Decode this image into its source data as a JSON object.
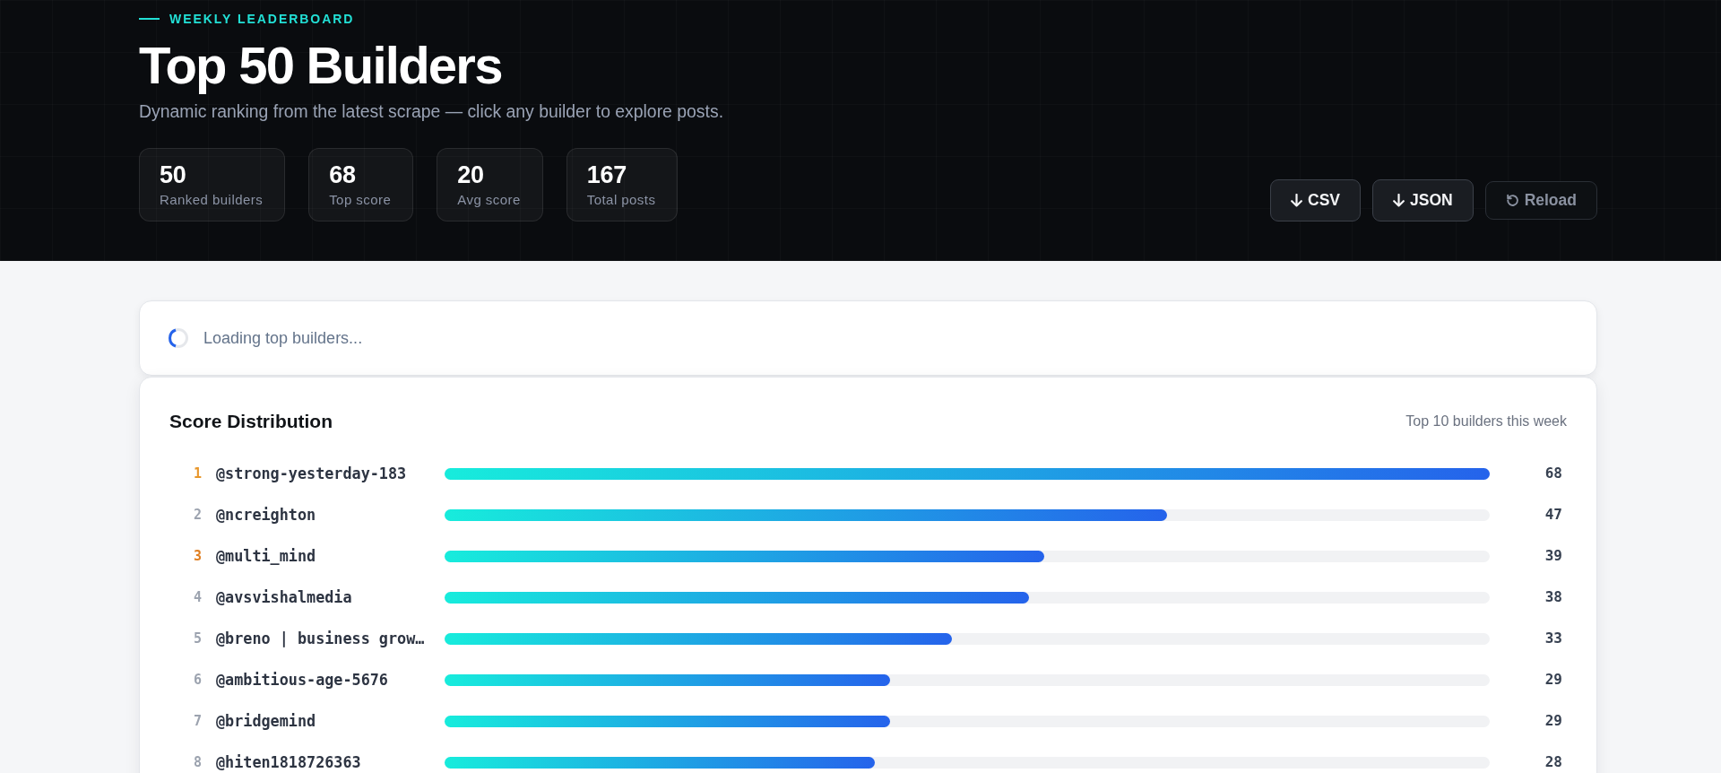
{
  "header": {
    "eyebrow": "WEEKLY LEADERBOARD",
    "title": "Top 50 Builders",
    "subtitle": "Dynamic ranking from the latest scrape — click any builder to explore posts.",
    "stats": [
      {
        "value": "50",
        "label": "Ranked builders"
      },
      {
        "value": "68",
        "label": "Top score"
      },
      {
        "value": "20",
        "label": "Avg score"
      },
      {
        "value": "167",
        "label": "Total posts"
      }
    ],
    "buttons": [
      {
        "kind": "download",
        "label": "CSV",
        "disabled": false
      },
      {
        "kind": "download",
        "label": "JSON",
        "disabled": false
      },
      {
        "kind": "reload",
        "label": "Reload",
        "disabled": true
      }
    ]
  },
  "loading": {
    "text": "Loading top builders..."
  },
  "distribution": {
    "title": "Score Distribution",
    "caption": "Top 10 builders this week",
    "rows": [
      {
        "rank": "1",
        "color": "#e8962a",
        "name": "@strong-yesterday-183",
        "level": 1,
        "score": "68"
      },
      {
        "rank": "2",
        "color": "#9ca3af",
        "name": "@ncreighton",
        "level": 0.691,
        "score": "47"
      },
      {
        "rank": "3",
        "color": "#e07f22",
        "name": "@multi_mind",
        "level": 0.574,
        "score": "39"
      },
      {
        "rank": "4",
        "color": "#9ca3af",
        "name": "@avsvishalmedia",
        "level": 0.559,
        "score": "38"
      },
      {
        "rank": "5",
        "color": "#9ca3af",
        "name": "@breno | business grow…",
        "level": 0.485,
        "score": "33"
      },
      {
        "rank": "6",
        "color": "#9ca3af",
        "name": "@ambitious-age-5676",
        "level": 0.426,
        "score": "29"
      },
      {
        "rank": "7",
        "color": "#9ca3af",
        "name": "@bridgemind",
        "level": 0.426,
        "score": "29"
      },
      {
        "rank": "8",
        "color": "#9ca3af",
        "name": "@hiten1818726363",
        "level": 0.412,
        "score": "28"
      }
    ]
  }
}
